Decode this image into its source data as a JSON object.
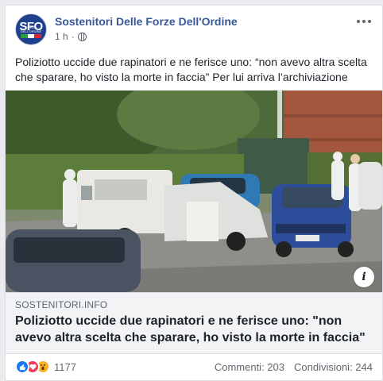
{
  "post": {
    "page_name": "Sostenitori Delle Forze Dell'Ordine",
    "time": "1 h",
    "avatar_logo": "SFO",
    "avatar_subtext": "FORZE DELL'ORDINE",
    "body_text": "Poliziotto uccide due rapinatori e ne ferisce uno: “non avevo altra scelta che sparare, ho visto la morte in faccia” Per lui arriva l’archiviazione"
  },
  "link": {
    "domain": "SOSTENITORI.INFO",
    "title": "Poliziotto uccide due rapinatori e ne ferisce uno: \"non avevo altra scelta che sparare, ho visto la morte in faccia\""
  },
  "photo": {
    "description_icon": "info-icon"
  },
  "footer": {
    "reaction_count": "1177",
    "comments": "Commenti: 203",
    "shares": "Condivisioni: 244"
  },
  "icons": [
    "globe-icon",
    "more-options-icon",
    "info-icon",
    "like-icon",
    "love-icon",
    "wow-icon"
  ],
  "colors": {
    "page_name": "#385898",
    "like": "#1877f2",
    "love": "#f33e58",
    "wow": "#f7b125",
    "link_box_bg": "#f2f3f5",
    "avatar_bg": "#1f3f8f"
  }
}
